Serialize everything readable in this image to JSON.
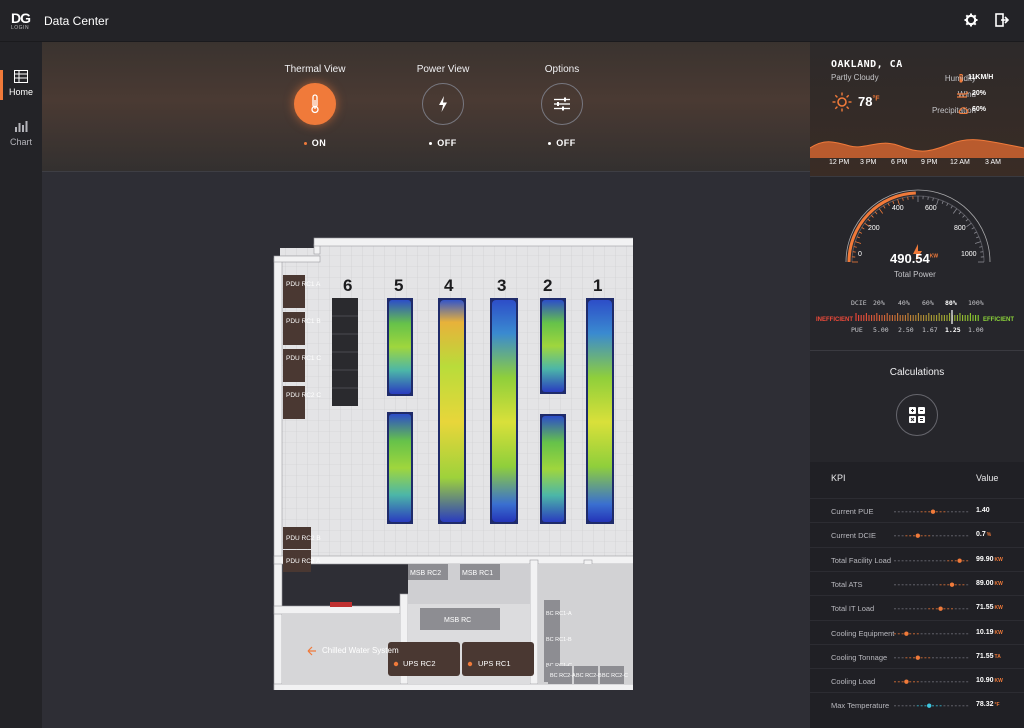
{
  "app": {
    "logo_text": "DG",
    "logo_sub": "LOGIN",
    "title": "Data Center"
  },
  "sidebar": {
    "items": [
      {
        "label": "Home",
        "icon": "home-grid-icon",
        "active": true
      },
      {
        "label": "Chart",
        "icon": "bar-chart-icon",
        "active": false
      }
    ]
  },
  "views": [
    {
      "label": "Thermal View",
      "state": "ON",
      "icon": "thermometer-icon",
      "active": true
    },
    {
      "label": "Power View",
      "state": "OFF",
      "icon": "lightning-icon",
      "active": false
    },
    {
      "label": "Options",
      "state": "OFF",
      "icon": "sliders-icon",
      "active": false
    }
  ],
  "floorplan": {
    "rack_numbers": [
      "6",
      "5",
      "4",
      "3",
      "2",
      "1"
    ],
    "pdus": [
      "PDU RC1 A",
      "PDU RC1 B",
      "PDU RC1 C",
      "PDU RC2 C",
      "PDU RC2 B",
      "PDU RC2 A"
    ],
    "msb": [
      "MSB RC2",
      "MSB RC1",
      "MSB RC"
    ],
    "ups": [
      "UPS RC2",
      "UPS RC1"
    ],
    "chilled_water": "Chilled Water System",
    "bc_units": [
      "BC RC1-A",
      "BC RC1-B",
      "BC RC1-C",
      "BC RC2-A",
      "BC RC2-B",
      "BC RC2-C"
    ]
  },
  "weather": {
    "city": "OAKLAND, CA",
    "condition": "Partly Cloudy",
    "temperature": "78",
    "temp_unit": "°F",
    "humidity_label": "Humidity",
    "humidity_value": "11KM/H",
    "wind_label": "Wind",
    "wind_value": "20%",
    "precip_label": "Precipitation",
    "precip_value": "60%",
    "hours": [
      "12 PM",
      "3 PM",
      "6 PM",
      "9 PM",
      "12 AM",
      "3 AM"
    ]
  },
  "power": {
    "gauge_ticks": [
      "0",
      "200",
      "400",
      "600",
      "800",
      "1000"
    ],
    "value": "490.54",
    "unit": "KW",
    "caption": "Total Power",
    "level": 0.49,
    "dcie_label": "DCIE",
    "dcie_ticks": [
      "20%",
      "40%",
      "60%",
      "80%",
      "100%"
    ],
    "pue_label": "PUE",
    "pue_ticks": [
      "5.00",
      "2.50",
      "1.67",
      "1.25",
      "1.00"
    ],
    "inefficient": "INEFFICIENT",
    "efficient": "EFFICIENT"
  },
  "calculations": {
    "title": "Calculations"
  },
  "kpi": {
    "header_name": "KPI",
    "header_value": "Value",
    "rows": [
      {
        "name": "Current PUE",
        "value": "1.40",
        "unit": "",
        "level": 0.5,
        "color": "#f07a3a"
      },
      {
        "name": "Current DCIE",
        "value": "0.7",
        "unit": "%",
        "level": 0.3,
        "color": "#f07a3a"
      },
      {
        "name": "Total Facility Load",
        "value": "99.90",
        "unit": "KW",
        "level": 0.9,
        "color": "#f07a3a"
      },
      {
        "name": "Total ATS",
        "value": "89.00",
        "unit": "KW",
        "level": 0.8,
        "color": "#f07a3a"
      },
      {
        "name": "Total IT Load",
        "value": "71.55",
        "unit": "KW",
        "level": 0.65,
        "color": "#f07a3a"
      },
      {
        "name": "Cooling Equipment",
        "value": "10.19",
        "unit": "KW",
        "level": 0.15,
        "color": "#f07a3a"
      },
      {
        "name": "Cooling Tonnage",
        "value": "71.55",
        "unit": "TA",
        "level": 0.3,
        "color": "#f07a3a"
      },
      {
        "name": "Cooling Load",
        "value": "10.90",
        "unit": "KW",
        "level": 0.15,
        "color": "#f07a3a"
      },
      {
        "name": "Max Temperature",
        "value": "78.32",
        "unit": "°F",
        "level": 0.45,
        "color": "#3ec7e0"
      }
    ]
  },
  "colors": {
    "accent": "#f07a3a",
    "cyan": "#3ec7e0",
    "green": "#8cd43a"
  }
}
